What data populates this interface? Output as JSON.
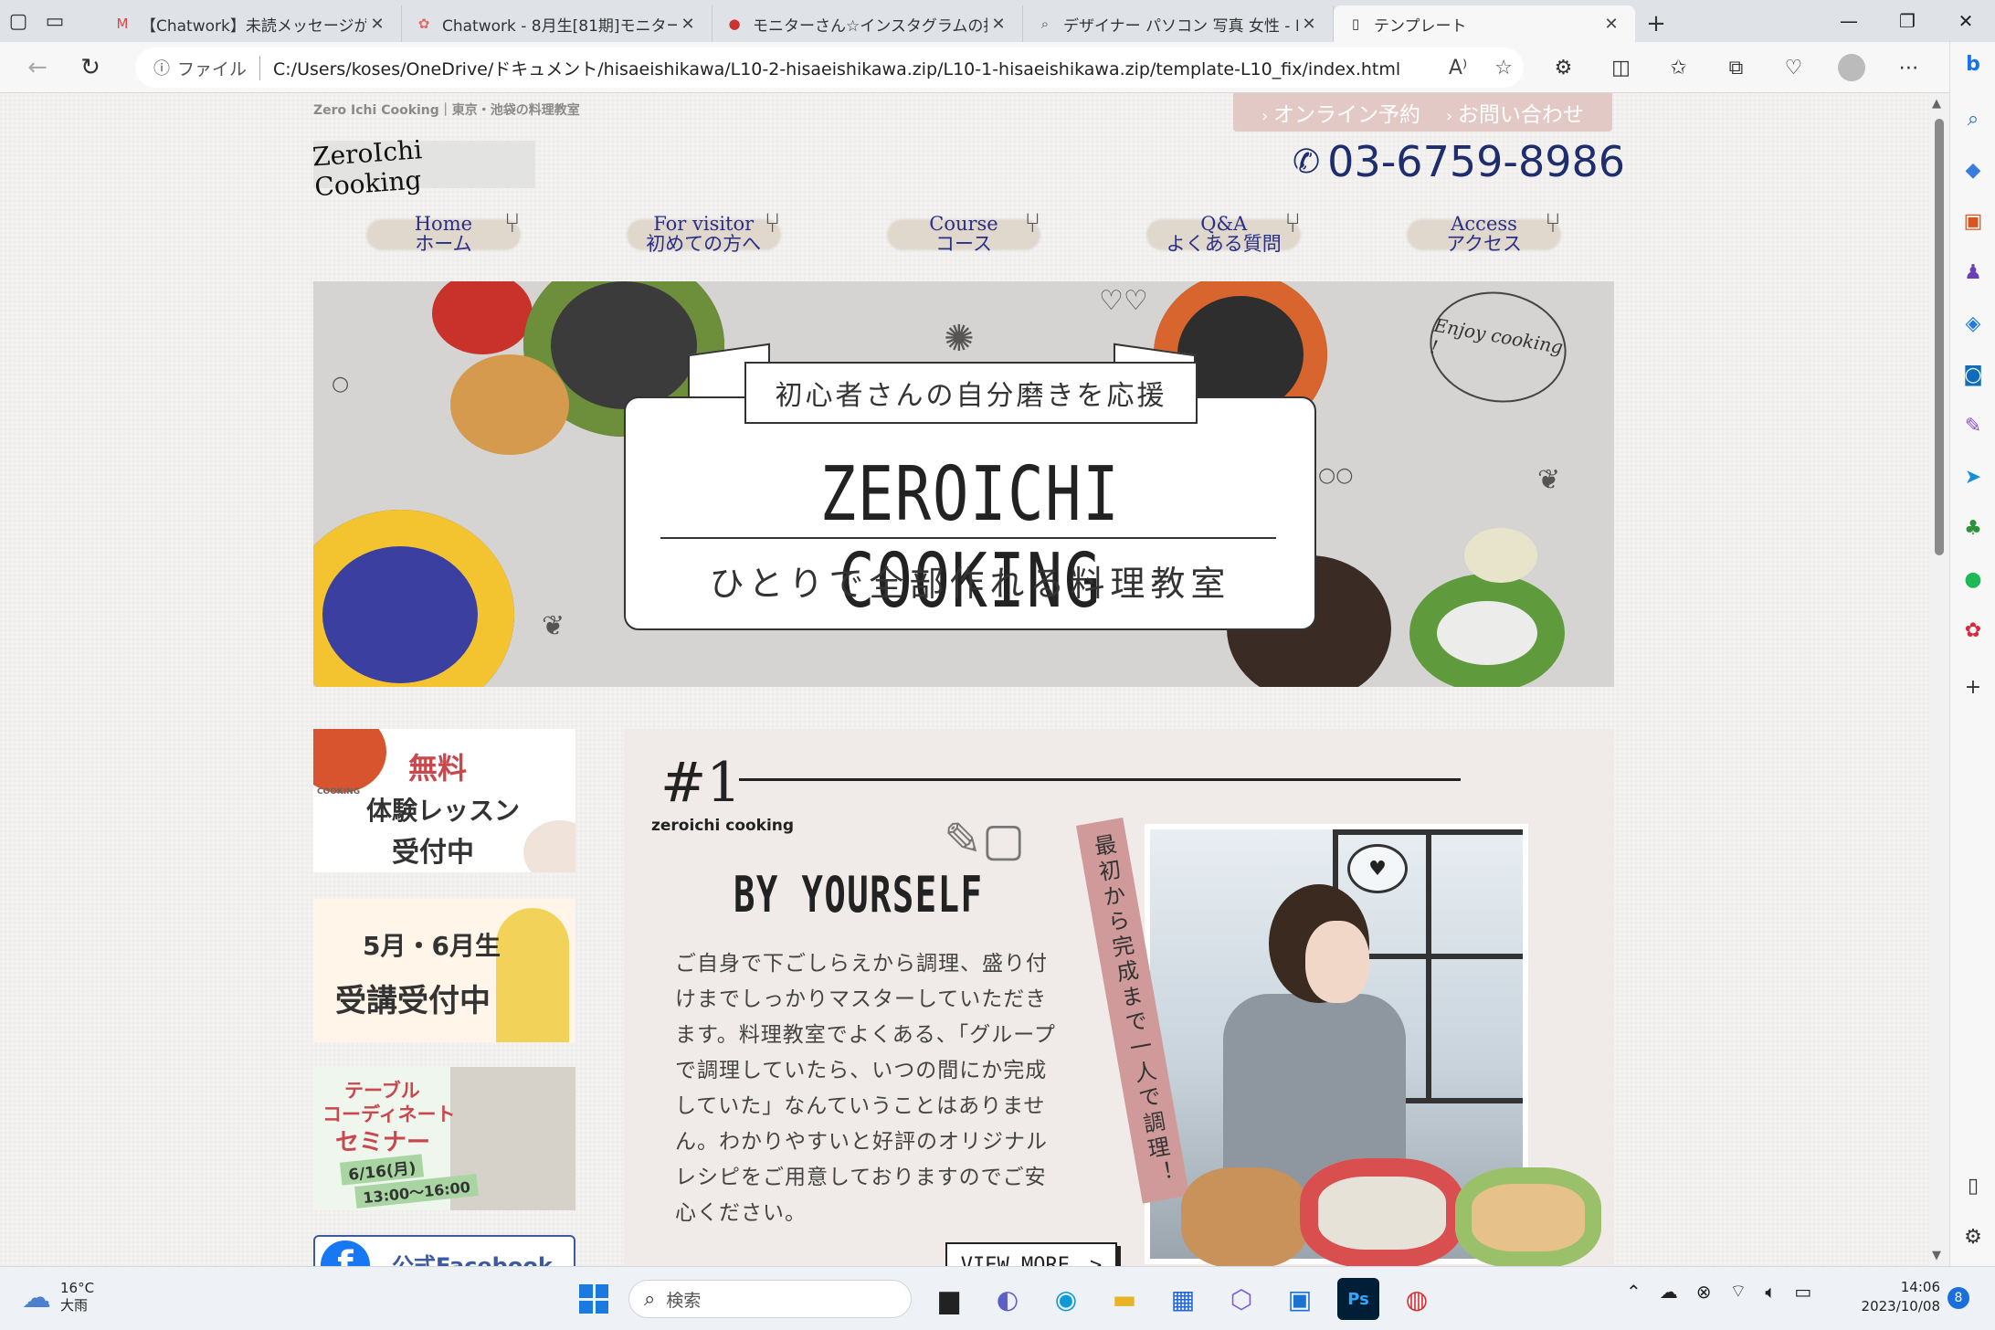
{
  "browser": {
    "tabs": [
      {
        "icon": "gmail-icon",
        "title": "【Chatwork】未読メッセージがありま"
      },
      {
        "icon": "chatwork-icon",
        "title": "Chatwork - 8月生[81期]モニター"
      },
      {
        "icon": "instagram-icon",
        "title": "モニターさん☆インスタグラムの投稿方"
      },
      {
        "icon": "bing-search-icon",
        "title": "デザイナー パソコン 写真 女性 - Bing"
      },
      {
        "icon": "document-icon",
        "title": "テンプレート",
        "active": true
      }
    ],
    "new_tab": "+",
    "window_controls": [
      "—",
      "❐",
      "✕"
    ],
    "address": {
      "scheme_label": "ファイル",
      "url": "C:/Users/koses/OneDrive/ドキュメント/hisaeishikawa/L10-2-hisaeishikawa.zip/L10-1-hisaeishikawa.zip/template-L10_fix/index.html"
    }
  },
  "page": {
    "tagline": "Zero Ichi Cooking｜東京・池袋の料理教室",
    "top_buttons": [
      "オンライン予約",
      "お問い合わせ"
    ],
    "logo": "ZeroIchi Cooking",
    "phone": "03-6759-8986",
    "nav": [
      {
        "en": "Home",
        "jp": "ホーム"
      },
      {
        "en": "For visitor",
        "jp": "初めての方へ"
      },
      {
        "en": "Course",
        "jp": "コース"
      },
      {
        "en": "Q&A",
        "jp": "よくある質問"
      },
      {
        "en": "Access",
        "jp": "アクセス"
      }
    ],
    "hero": {
      "ribbon": "初心者さんの自分磨きを応援",
      "title": "ZEROICHI COOKING",
      "subtitle": "ひとりで全部作れる料理教室",
      "enjoy": "Enjoy cooking !"
    },
    "banners": {
      "free_trial": {
        "line1": "無料",
        "line2": "体験レッスン",
        "line3": "受付中",
        "tag": "COOKING"
      },
      "enrollment": {
        "line1": "5月・6月生",
        "line2": "受講受付中"
      },
      "seminar": {
        "line1": "テーブル",
        "line2": "コーディネート",
        "line3": "セミナー",
        "date": "6/16(月)",
        "time": "13:00〜16:00"
      },
      "facebook": {
        "label": "公式Facebook"
      }
    },
    "feature": {
      "number": "#1",
      "brand": "zeroichi cooking",
      "heading": "BY YOURSELF",
      "vertical_tag": "最初から完成まで一人で調理！",
      "body": "ご自身で下ごしらえから調理、盛り付けまでしっかりマスターしていただきます。料理教室でよくある、「グループで調理していたら、いつの間にか完成していた」なんていうことはありません。わかりやすいと好評のオリジナルレシピをご用意しておりますのでご安心ください。",
      "view_more": "VIEW MORE　>"
    }
  },
  "taskbar": {
    "weather_temp": "16°C",
    "weather_desc": "大雨",
    "search_placeholder": "検索",
    "time": "14:06",
    "date": "2023/10/08",
    "notifications": "8"
  }
}
